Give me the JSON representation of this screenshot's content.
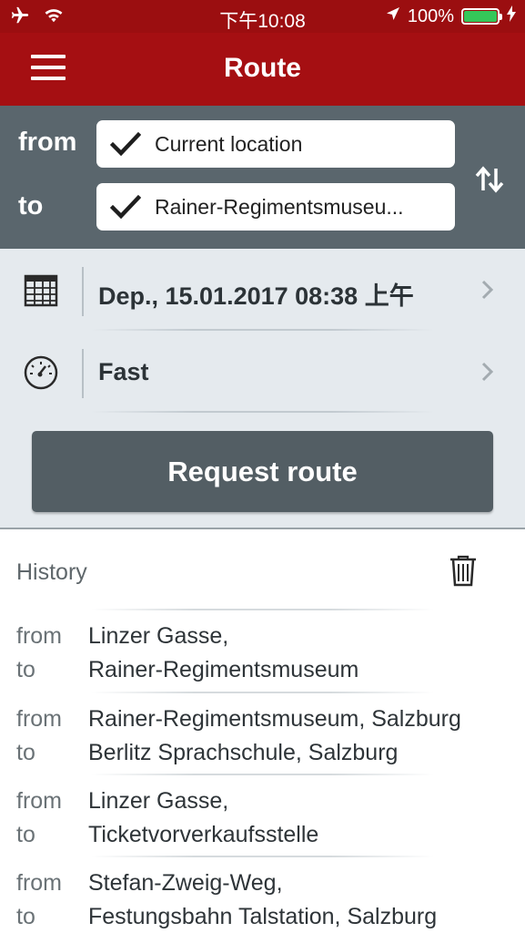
{
  "status_bar": {
    "time": "下午10:08",
    "battery": "100%",
    "battery_level": 1.0
  },
  "header": {
    "title": "Route"
  },
  "route": {
    "from_label": "from",
    "to_label": "to",
    "from_value": "Current location",
    "to_value": "Rainer-Regimentsmuseu..."
  },
  "options": {
    "departure": "Dep., 15.01.2017 08:38 上午",
    "mode": "Fast"
  },
  "request_button": "Request route",
  "history": {
    "title": "History",
    "items": [
      {
        "from_label": "from",
        "to_label": "to",
        "from": "Linzer Gasse,",
        "to": "Rainer-Regimentsmuseum"
      },
      {
        "from_label": "from",
        "to_label": "to",
        "from": "Rainer-Regimentsmuseum, Salzburg",
        "to": "Berlitz Sprachschule, Salzburg"
      },
      {
        "from_label": "from",
        "to_label": "to",
        "from": "Linzer Gasse,",
        "to": "Ticketvorverkaufsstelle"
      },
      {
        "from_label": "from",
        "to_label": "to",
        "from": "Stefan-Zweig-Weg,",
        "to": "Festungsbahn Talstation, Salzburg"
      }
    ]
  },
  "icons": {
    "status_left": [
      "airplane-icon",
      "wifi-icon"
    ],
    "status_right": [
      "location-arrow-icon",
      "battery-icon",
      "charging-icon"
    ],
    "nav": "menu-icon",
    "swap": "swap-icon",
    "calendar": "calendar-icon",
    "speed": "speedometer-icon",
    "trash": "trash-icon"
  },
  "colors": {
    "brand_red": "#a50f12",
    "panel_gray": "#5a666d",
    "button_gray": "#535e64",
    "battery_green": "#35c759"
  }
}
